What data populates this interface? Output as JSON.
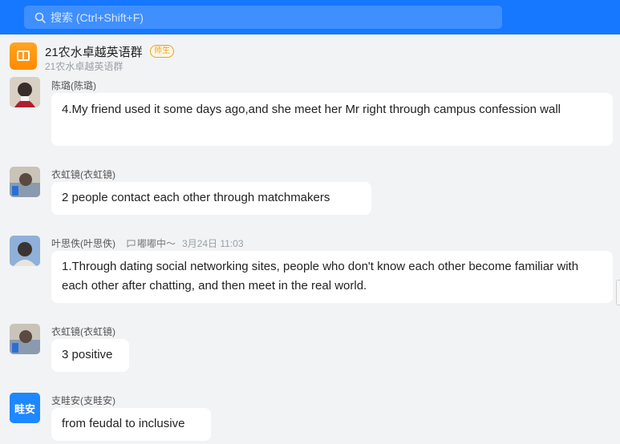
{
  "search": {
    "placeholder": "搜索 (Ctrl+Shift+F)"
  },
  "group": {
    "title": "21农水卓越英语群",
    "badge": "师生",
    "subtitle": "21农水卓越英语群"
  },
  "messages": [
    {
      "name": "陈璐(陈璐)",
      "text": "4.My friend used it some days ago,and she meet her  Mr right through campus confession wall"
    },
    {
      "name": "衣虹镜(衣虹镜)",
      "text": "2 people contact each other through matchmakers"
    },
    {
      "name": "叶思佚(叶思佚)",
      "status": "嘟嘟中～",
      "time": "3月24日 11:03",
      "text": "1.Through dating social networking sites, people who don't know each other become familiar with each other after chatting, and then meet in the real world."
    },
    {
      "name": "衣虹镜(衣虹镜)",
      "text": "3 positive"
    },
    {
      "name": "支畦安(支畦安)",
      "avatar_text": "畦安",
      "text": "from feudal to inclusive"
    }
  ],
  "colors": {
    "accent": "#1677ff",
    "badge": "#f0a020",
    "avatar_text_bg": "#1e88ff"
  }
}
